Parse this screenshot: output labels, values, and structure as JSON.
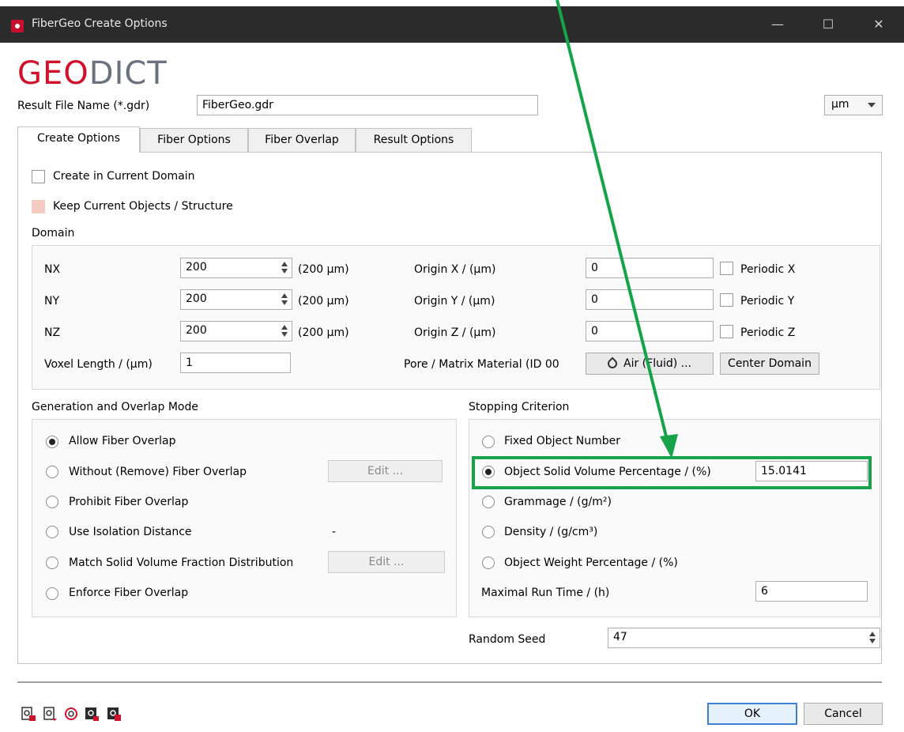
{
  "window": {
    "title": "FiberGeo Create Options"
  },
  "logo": {
    "part1": "GEO",
    "part2": "DICT"
  },
  "result_file": {
    "label": "Result File Name (*.gdr)",
    "value": "FiberGeo.gdr"
  },
  "unit_select": {
    "value": "µm"
  },
  "tabs": [
    "Create Options",
    "Fiber Options",
    "Fiber Overlap",
    "Result Options"
  ],
  "options": {
    "create_in_domain": "Create in Current Domain",
    "keep_current": "Keep Current Objects / Structure"
  },
  "domain": {
    "section_label": "Domain",
    "nx": {
      "label": "NX",
      "value": "200",
      "size": "(200 µm)"
    },
    "ny": {
      "label": "NY",
      "value": "200",
      "size": "(200 µm)"
    },
    "nz": {
      "label": "NZ",
      "value": "200",
      "size": "(200 µm)"
    },
    "voxel_label": "Voxel Length / (µm)",
    "voxel_value": "1",
    "origin_x": {
      "label": "Origin X / (µm)",
      "value": "0"
    },
    "origin_y": {
      "label": "Origin Y / (µm)",
      "value": "0"
    },
    "origin_z": {
      "label": "Origin Z / (µm)",
      "value": "0"
    },
    "periodic_x": "Periodic X",
    "periodic_y": "Periodic Y",
    "periodic_z": "Periodic Z",
    "material_label": "Pore / Matrix Material (ID 00",
    "material_button": "Air (Fluid) ...",
    "center_button": "Center Domain"
  },
  "overlap": {
    "section_label": "Generation and Overlap Mode",
    "items": [
      "Allow Fiber Overlap",
      "Without (Remove) Fiber Overlap",
      "Prohibit Fiber Overlap",
      "Use Isolation Distance",
      "Match Solid Volume Fraction Distribution",
      "Enforce Fiber Overlap"
    ],
    "selected": 0,
    "edit_label": "Edit ...",
    "isolation_value": "-"
  },
  "stopping": {
    "section_label": "Stopping Criterion",
    "items": [
      "Fixed Object Number",
      "Object Solid Volume Percentage / (%)",
      "Grammage / (g/m²)",
      "Density / (g/cm³)",
      "Object Weight Percentage / (%)"
    ],
    "selected": 1,
    "solid_volume_value": "15.0141",
    "runtime_label": "Maximal Run Time / (h)",
    "runtime_value": "6"
  },
  "random_seed": {
    "label": "Random Seed",
    "value": "47"
  },
  "footer": {
    "ok": "OK",
    "cancel": "Cancel"
  },
  "colors": {
    "accent": "#d1112b",
    "annotation": "#17a34a",
    "default_button_border": "#3c7fd4"
  },
  "icons": [
    "load-settings-icon",
    "save-settings-icon",
    "reset-settings-icon",
    "export-macro-icon",
    "import-macro-icon"
  ]
}
